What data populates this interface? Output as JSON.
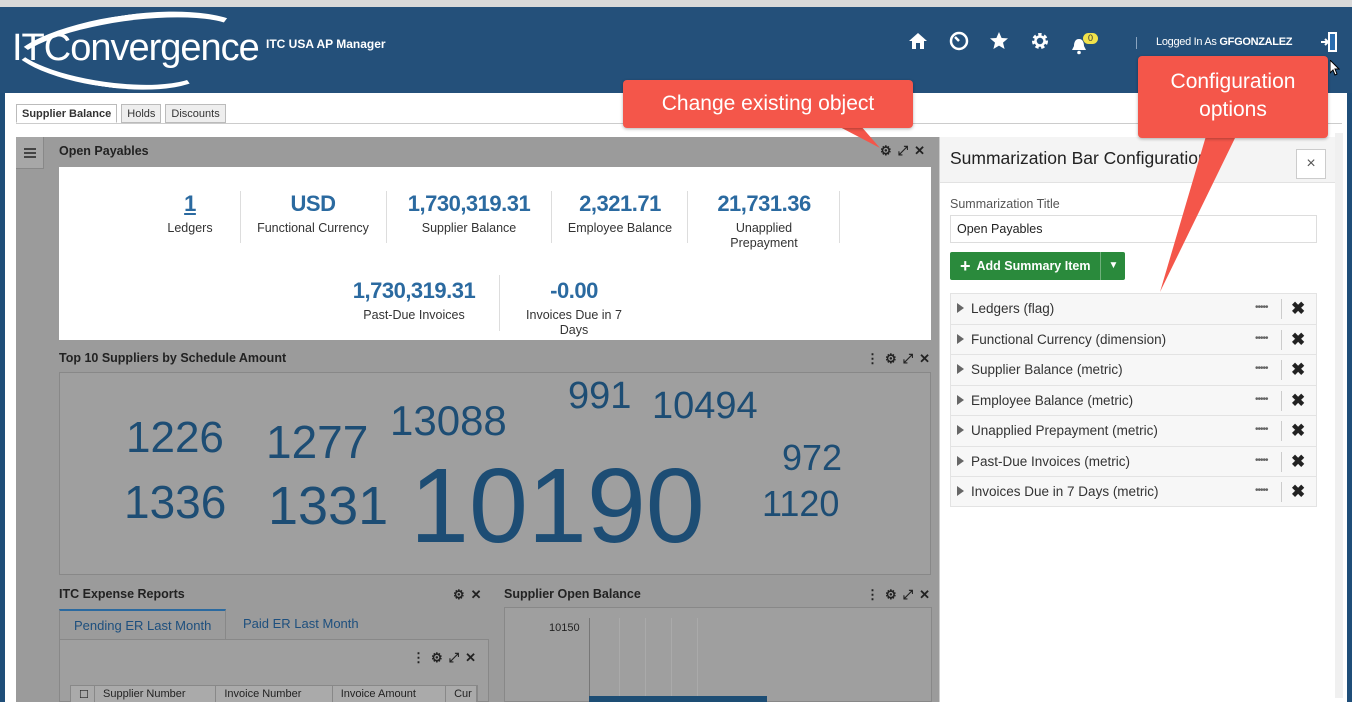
{
  "header": {
    "logo_text": "ITConvergence",
    "app_title": "ITC USA AP Manager",
    "notification_count": "0",
    "logged_in_prefix": "Logged In As ",
    "logged_in_user": "GFGONZALEZ"
  },
  "tabs": [
    "Supplier Balance",
    "Holds",
    "Discounts"
  ],
  "open_payables": {
    "title": "Open Payables",
    "metrics": [
      {
        "value": "1",
        "label": "Ledgers"
      },
      {
        "value": "USD",
        "label": "Functional Currency"
      },
      {
        "value": "1,730,319.31",
        "label": "Supplier Balance"
      },
      {
        "value": "2,321.71",
        "label": "Employee Balance"
      },
      {
        "value": "21,731.36",
        "label": "Unapplied Prepayment"
      },
      {
        "value": "1,730,319.31",
        "label": "Past-Due Invoices"
      },
      {
        "value": "-0.00",
        "label": "Invoices Due in 7 Days"
      }
    ]
  },
  "top_suppliers": {
    "title": "Top 10 Suppliers by Schedule Amount",
    "numbers": [
      "1226",
      "1277",
      "13088",
      "991",
      "10494",
      "972",
      "1336",
      "1331",
      "10190",
      "1120"
    ]
  },
  "expense_reports": {
    "title": "ITC Expense Reports",
    "tabs": [
      "Pending ER Last Month",
      "Paid ER Last Month"
    ],
    "columns": [
      "Supplier Number",
      "Invoice Number",
      "Invoice Amount",
      "Cur"
    ]
  },
  "supplier_open_balance": {
    "title": "Supplier Open Balance",
    "y_tick": "10150"
  },
  "config": {
    "title": "Summarization Bar Configuration",
    "close_glyph": "×",
    "field_label": "Summarization Title",
    "field_value": "Open Payables",
    "add_button": "Add Summary Item",
    "items": [
      "Ledgers (flag)",
      "Functional Currency (dimension)",
      "Supplier Balance (metric)",
      "Employee Balance (metric)",
      "Unapplied Prepayment (metric)",
      "Past-Due Invoices (metric)",
      "Invoices Due in 7 Days (metric)"
    ]
  },
  "callouts": {
    "change_object": "Change existing object",
    "config_options_line1": "Configuration",
    "config_options_line2": "options"
  },
  "colors": {
    "header_bg": "#24507a",
    "metric_value": "#2b6aa0",
    "add_button": "#2a8a3c",
    "callout": "#f4564a"
  }
}
